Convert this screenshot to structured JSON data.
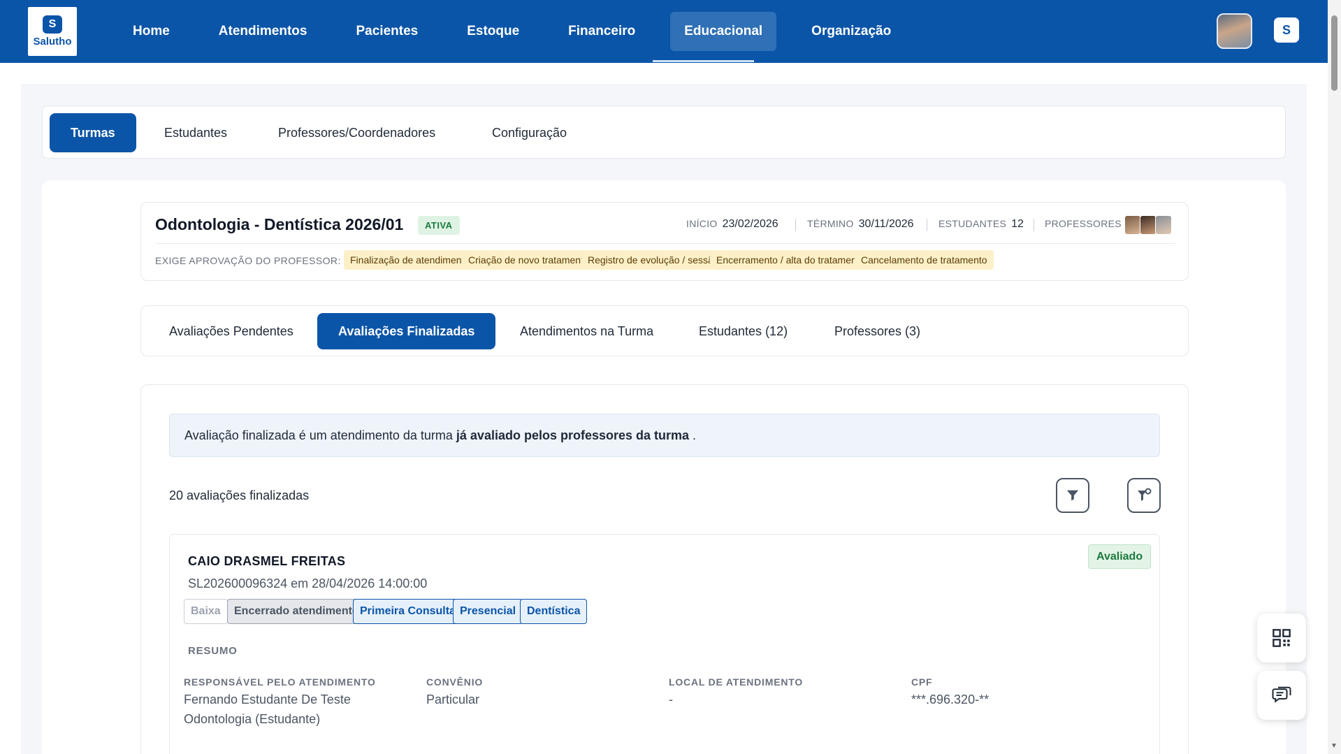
{
  "app": {
    "logo_text": "Salutho",
    "logo_mark": "S"
  },
  "nav": {
    "items": [
      "Home",
      "Atendimentos",
      "Pacientes",
      "Estoque",
      "Financeiro",
      "Educacional",
      "Organização"
    ],
    "active": "Educacional"
  },
  "section_tabs": {
    "items": [
      "Turmas",
      "Estudantes",
      "Professores/Coordenadores",
      "Configuração"
    ],
    "active": "Turmas"
  },
  "course": {
    "title": "Odontologia - Dentística 2026/01",
    "status": "ATIVA",
    "start_label": "INÍCIO",
    "start_date": "23/02/2026",
    "end_label": "TÉRMINO",
    "end_date": "30/11/2026",
    "students_label": "ESTUDANTES",
    "students_count": "12",
    "professors_label": "PROFESSORES",
    "approval_label": "EXIGE APROVAÇÃO DO PROFESSOR:",
    "approval_items": [
      "Finalização de atendimento",
      "Criação de novo tratamento",
      "Registro de evolução / sessão",
      "Encerramento / alta do tratamento",
      "Cancelamento de tratamento"
    ]
  },
  "sub_tabs": {
    "items": [
      "Avaliações Pendentes",
      "Avaliações Finalizadas",
      "Atendimentos na Turma",
      "Estudantes (12)",
      "Professores (3)"
    ],
    "active": "Avaliações Finalizadas"
  },
  "info": {
    "prefix": "Avaliação finalizada é um atendimento da turma",
    "bold": "já avaliado pelos professores da turma",
    "suffix": "."
  },
  "list": {
    "count_text": "20 avaliações finalizadas"
  },
  "record": {
    "patient_name": "CAIO DRASMEL FREITAS",
    "badge": "Avaliado",
    "meta": "SL202600096324 em 28/04/2026 14:00:00",
    "tags": [
      "Baixa",
      "Encerrado atendimento",
      "Primeira Consulta",
      "Presencial",
      "Dentística"
    ],
    "section_label": "RESUMO",
    "fields": [
      {
        "key": "RESPONSÁVEL PELO ATENDIMENTO",
        "value_line1": "Fernando Estudante De Teste",
        "value_line2": "Odontologia (Estudante)"
      },
      {
        "key": "CONVÊNIO",
        "value_line1": "Particular",
        "value_line2": ""
      },
      {
        "key": "LOCAL DE ATENDIMENTO",
        "value_line1": "-",
        "value_line2": ""
      },
      {
        "key": "CPF",
        "value_line1": "***.696.320-**",
        "value_line2": ""
      }
    ]
  },
  "colors": {
    "primary": "#0b55a8",
    "success": "#1b7a3c",
    "warning_bg": "#fdf0c8"
  },
  "icons": {
    "filter": "filter-icon",
    "filter_settings": "filter-settings-icon",
    "qr": "qr-code-icon",
    "chat": "chat-icon"
  }
}
